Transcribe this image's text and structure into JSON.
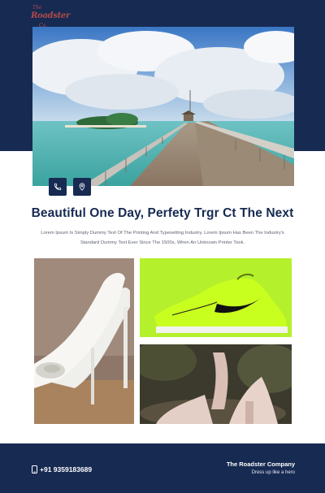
{
  "brand": {
    "logo_line1": "The",
    "logo_line2": "Roadster",
    "logo_line3": "Co."
  },
  "hero": {
    "image": "tropical-beach-pier-photo",
    "contact_icons": [
      "phone-icon",
      "location-pin-icon"
    ]
  },
  "main": {
    "headline": "Beautiful One Day, Perfety Trgr Ct The Next",
    "body": "Lorem Ipsum Is Simply Dummy Text Of The Printing And Typesetting Industry. Lorem Ipsum Has Been The Industry's Standard Dummy Text Ever Since The 1500s, When An Unknown Printer Took."
  },
  "gallery": [
    {
      "image": "white-heeled-sandals-photo"
    },
    {
      "image": "neon-green-sneaker-photo"
    },
    {
      "image": "pink-block-heel-sandals-photo"
    }
  ],
  "footer": {
    "phone": "+91 9359183689",
    "company": "The Roadster Company",
    "tagline": "Dress up like a hero"
  },
  "colors": {
    "navy": "#172a52",
    "headline": "#172a52",
    "body_text": "#5e6470",
    "sneaker_bg": "#b5f02c",
    "logo": "#b34a49"
  }
}
